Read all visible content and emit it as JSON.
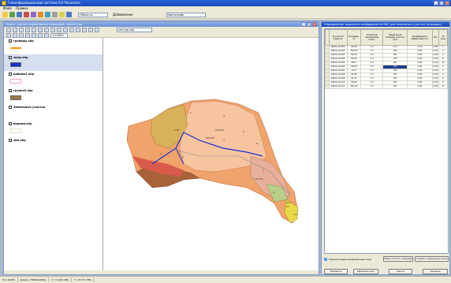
{
  "app": {
    "title": "Геоинформационная система 6.0 Panorama",
    "menu": [
      "Файл",
      "Правка"
    ]
  },
  "toolbar": {
    "layer_combo": "Объекты",
    "view_combo": "Картограф",
    "mode_label": "Добавление"
  },
  "map_window": {
    "title": "Карта - расчет нормативных площадей - layers.map",
    "scale_value": "1:10000",
    "file_combo": "контур.shp",
    "layers": [
      {
        "name": "границы.shp",
        "swatch": "#ff9a00",
        "style": "line"
      },
      {
        "name": "зоны.shp",
        "swatch": "#1a2fd0",
        "style": "fill",
        "selected": true
      },
      {
        "name": "районы1.shp",
        "swatch": "#f0a0d0",
        "style": "outline"
      },
      {
        "name": "группа2.shp",
        "swatch": "#9c7a44",
        "style": "fill"
      },
      {
        "name": "Земельные участки",
        "swatch": "",
        "style": "group"
      },
      {
        "name": "водоем.shp",
        "swatch": "#d9e4c0",
        "style": "outline"
      },
      {
        "name": "зем.shp",
        "swatch": "",
        "style": "none"
      }
    ],
    "map_labels": [
      "1.01",
      "1",
      "244,59",
      "3",
      "2",
      "4",
      "5",
      "6",
      "7",
      "9",
      "11",
      "10",
      "200,00",
      "3",
      "127,76",
      "117"
    ]
  },
  "table_window": {
    "title": "Определение заданного коэффициента ВаС для земельного участка (площадь)",
    "columns": [
      "№ участка кадастр.",
      "Площадь, га",
      "Норматив занимаемой площ.",
      "Предельная площадь участка, кв.м",
      "Коэффициент эффективности",
      "КоС",
      "№ зоны"
    ],
    "rows": [
      [
        "Район № 001",
        "26,28",
        "1,5",
        "3,17",
        "2,79",
        "0,00",
        "1"
      ],
      [
        "Район № 002",
        "102,00",
        "1,5",
        "100",
        "0,00",
        "0,00",
        "7"
      ],
      [
        "Район № 003",
        "99,50",
        "1,5",
        "101",
        "0,00",
        "0,00",
        "2"
      ],
      [
        "Район № 004",
        "84,00",
        "1,4",
        "103",
        "0,00",
        "0,00",
        "8"
      ],
      [
        "Район № 005",
        "184,7",
        "1,5",
        "101",
        "0,00",
        "0,00",
        "12"
      ],
      [
        "Район № 006",
        "99,00",
        "1,5",
        "101",
        "0,00",
        "0,00",
        "4"
      ],
      [
        "Район № 007",
        "21,0",
        "1,5",
        "100",
        "0,00",
        "0,00",
        "5"
      ],
      [
        "Район № 008",
        "22,40",
        "1,5",
        "101",
        "0,00",
        "0,00",
        "3"
      ],
      [
        "Район № 009",
        "32,17",
        "1,5",
        "101",
        "0,00",
        "0,00",
        "9"
      ],
      [
        "Район № 010",
        "30,04",
        "1,5",
        "101",
        "0,00",
        "0,00",
        "6"
      ],
      [
        "Район № 011",
        "164,00",
        "1,5",
        "101",
        "0,00",
        "0,00",
        "11"
      ]
    ],
    "highlight_row": 5,
    "checkbox_label": "Пересчитывать выделенные зоны",
    "buttons": {
      "recalc": "Пересчитать площадь",
      "create_zones": "Создать земельные зоны",
      "refresh": "Обновить",
      "update_koc": "Обновить КоС",
      "map": "Карта",
      "close": "Закрыть"
    }
  },
  "status": {
    "scale": "М 1:10000",
    "coords": "Длина: 79804,00М/м",
    "x": "X = 6 415 386",
    "y": "Y = 8 571 456"
  }
}
